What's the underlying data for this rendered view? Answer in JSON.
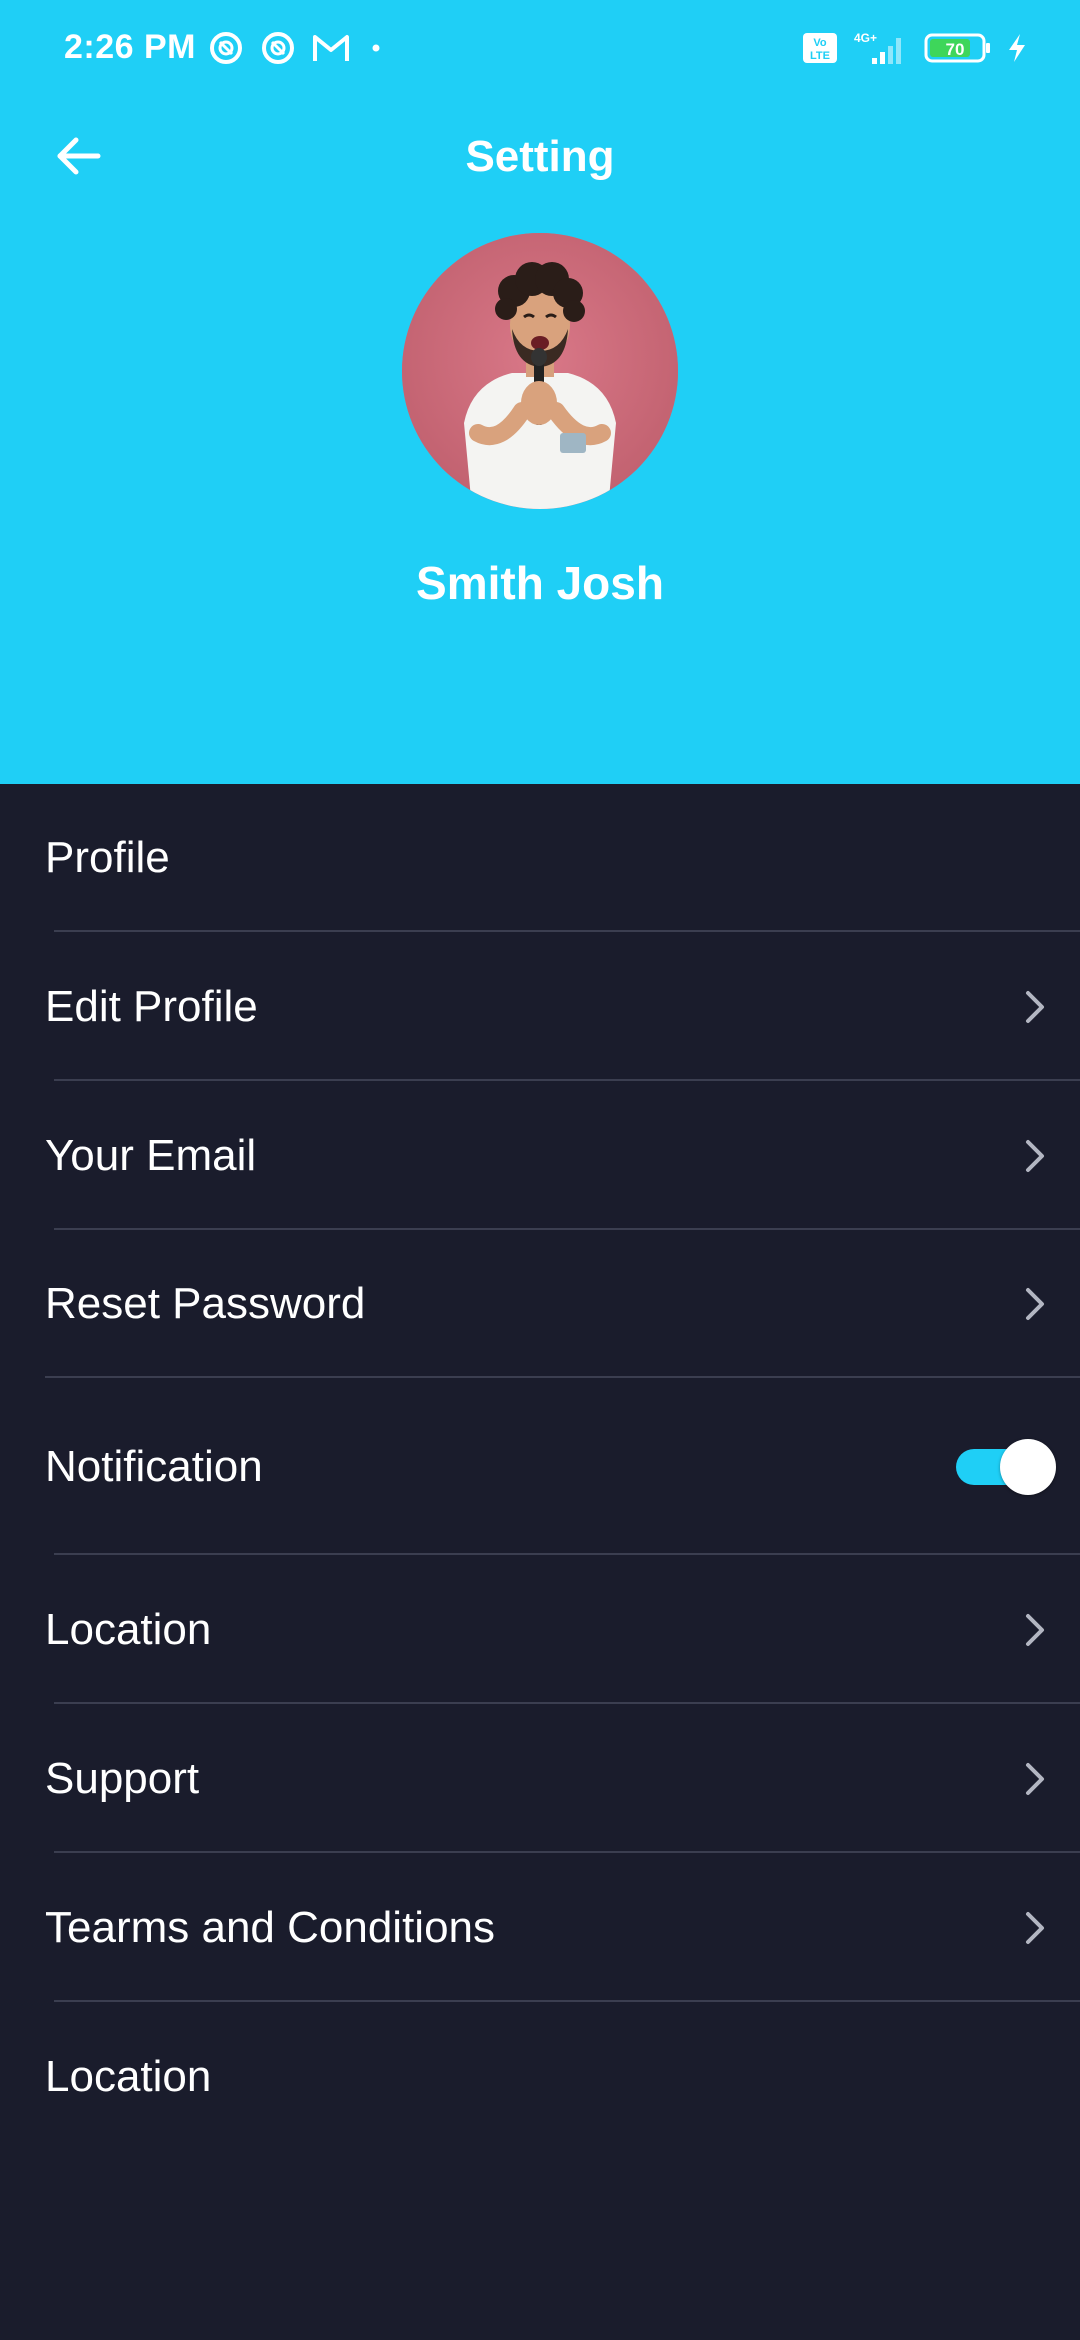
{
  "status_bar": {
    "time": "2:26 PM",
    "left_icons": [
      "sync-icon",
      "sync-icon",
      "gmail-icon",
      "dot-icon"
    ],
    "right_icons": [
      "volte-icon",
      "signal-4g-icon",
      "battery-icon",
      "charging-icon"
    ],
    "network": "4G+",
    "volte": "Vo LTE",
    "battery": "70"
  },
  "header": {
    "title": "Setting",
    "back_icon": "arrow-left-icon",
    "user_name": "Smith Josh",
    "background_color": "#1fcff6"
  },
  "list": {
    "items": [
      {
        "label": "Profile"
      },
      {
        "label": "Edit Profile",
        "icon": "chevron-right-icon"
      },
      {
        "label": "Your Email",
        "icon": "chevron-right-icon"
      },
      {
        "label": "Reset Password",
        "icon": "chevron-right-icon"
      },
      {
        "label": "Notification",
        "toggle": true,
        "toggle_on": true
      },
      {
        "label": "Location",
        "icon": "chevron-right-icon"
      },
      {
        "label": "Support",
        "icon": "chevron-right-icon"
      },
      {
        "label": "Tearms and Conditions",
        "icon": "chevron-right-icon"
      },
      {
        "label": "Location"
      }
    ],
    "background_color": "#1a1c2c",
    "accent_color": "#1fcff6"
  }
}
